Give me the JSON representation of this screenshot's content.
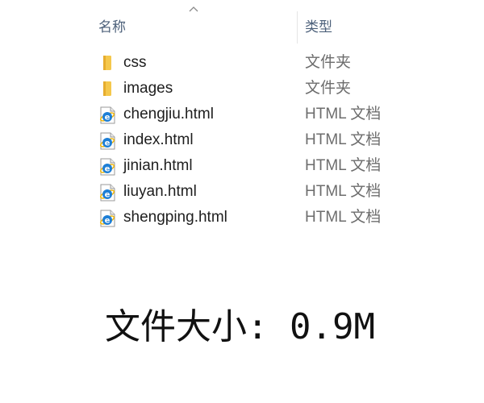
{
  "explorer": {
    "sort_indicator": "ascending",
    "columns": {
      "name": "名称",
      "type": "类型"
    },
    "rows": [
      {
        "icon": "folder-icon",
        "name": "css",
        "type": "文件夹"
      },
      {
        "icon": "folder-icon",
        "name": "images",
        "type": "文件夹"
      },
      {
        "icon": "ie-html-file-icon",
        "name": "chengjiu.html",
        "type": "HTML 文档"
      },
      {
        "icon": "ie-html-file-icon",
        "name": "index.html",
        "type": "HTML 文档"
      },
      {
        "icon": "ie-html-file-icon",
        "name": "jinian.html",
        "type": "HTML 文档"
      },
      {
        "icon": "ie-html-file-icon",
        "name": "liuyan.html",
        "type": "HTML 文档"
      },
      {
        "icon": "ie-html-file-icon",
        "name": "shengping.html",
        "type": "HTML 文档"
      }
    ],
    "colors": {
      "header_text": "#4c607a",
      "type_text": "#6d6d6d",
      "folder_yellow": "#f5c84c",
      "ie_blue": "#1e7fd6"
    }
  },
  "caption": {
    "file_size": "文件大小: 0.9M"
  }
}
